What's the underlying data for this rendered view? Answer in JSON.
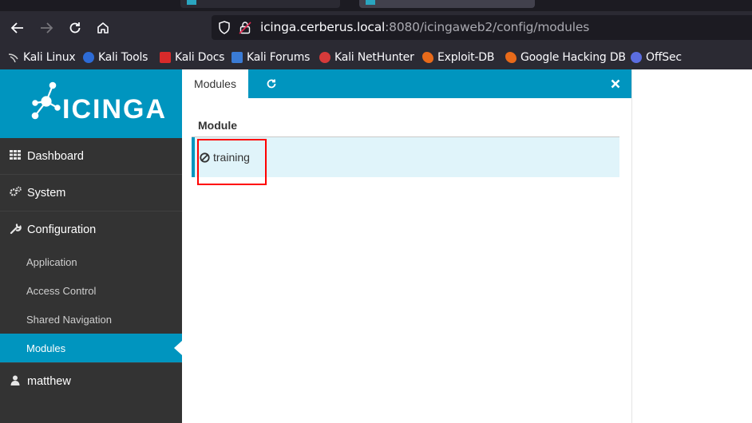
{
  "browser": {
    "url_host": "icinga.cerberus.local",
    "url_rest": ":8080/icingaweb2/config/modules",
    "bookmarks": [
      {
        "label": "Kali Linux",
        "icon": "kali-dragon-icon",
        "color": "#cfcfcf"
      },
      {
        "label": "Kali Tools",
        "icon": "kali-tools-icon",
        "color": "#2d6bd6"
      },
      {
        "label": "Kali Docs",
        "icon": "kali-docs-icon",
        "color": "#d82a2a"
      },
      {
        "label": "Kali Forums",
        "icon": "kali-forums-icon",
        "color": "#3a7bd5"
      },
      {
        "label": "Kali NetHunter",
        "icon": "nethunter-icon",
        "color": "#d63a3a"
      },
      {
        "label": "Exploit-DB",
        "icon": "exploit-db-icon",
        "color": "#e86a1a"
      },
      {
        "label": "Google Hacking DB",
        "icon": "ghdb-icon",
        "color": "#e86a1a"
      },
      {
        "label": "OffSec",
        "icon": "offsec-icon",
        "color": "#5b6de0"
      }
    ]
  },
  "brand": {
    "name": "icinga",
    "color": "#0095bf"
  },
  "sidebar": {
    "items": [
      {
        "label": "Dashboard",
        "icon": "grid-icon"
      },
      {
        "label": "System",
        "icon": "gears-icon"
      },
      {
        "label": "Configuration",
        "icon": "wrench-icon"
      }
    ],
    "configuration_subitems": [
      {
        "label": "Application"
      },
      {
        "label": "Access Control"
      },
      {
        "label": "Shared Navigation"
      },
      {
        "label": "Modules",
        "active": true
      }
    ],
    "user": {
      "label": "matthew",
      "icon": "user-icon"
    }
  },
  "main": {
    "tab_label": "Modules",
    "table": {
      "header": "Module",
      "rows": [
        {
          "name": "training",
          "status_icon": "disabled-circle-icon"
        }
      ]
    }
  }
}
